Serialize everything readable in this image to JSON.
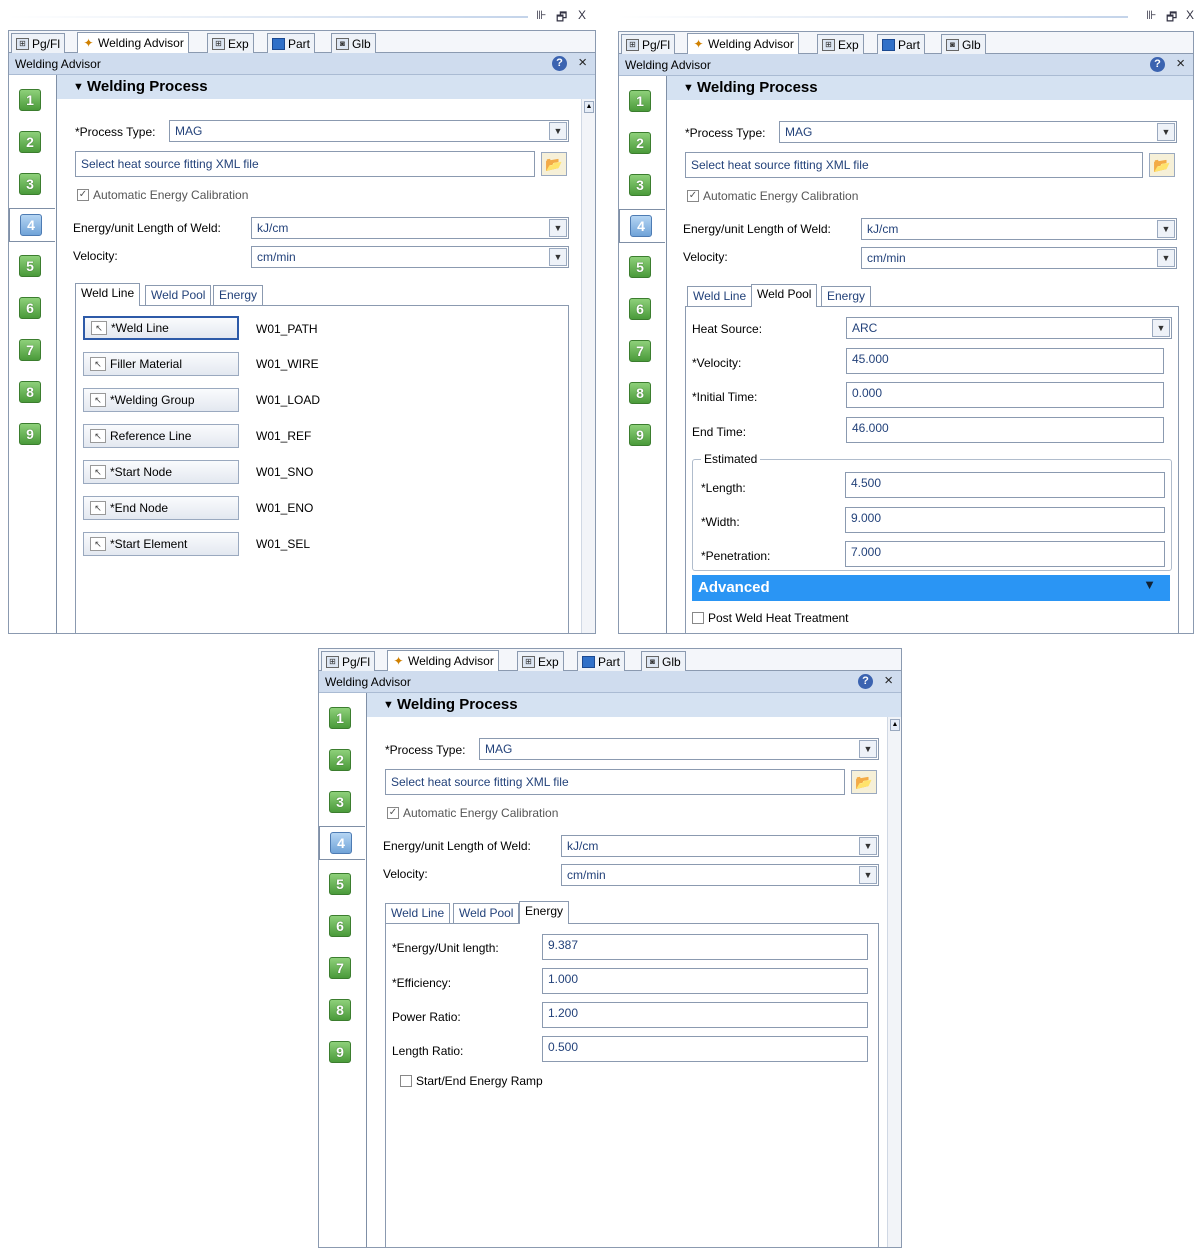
{
  "tabs": {
    "pgfl": "Pg/Fl",
    "welding_advisor": "Welding Advisor",
    "exp": "Exp",
    "part": "Part",
    "glb": "Glb"
  },
  "dock": {
    "pin": "⊪",
    "restore": "🗗",
    "close": "X"
  },
  "header": {
    "title": "Welding Advisor",
    "help": "?",
    "close": "×"
  },
  "steps": [
    "1",
    "2",
    "3",
    "4",
    "5",
    "6",
    "7",
    "8",
    "9"
  ],
  "section_title": "Welding Process",
  "process": {
    "process_type_label": "*Process Type:",
    "process_type_value": "MAG",
    "xml_placeholder": "Select heat source fitting XML file",
    "auto_calibration": "Automatic Energy Calibration",
    "energy_label": "Energy/unit Length of Weld:",
    "energy_unit": "kJ/cm",
    "velocity_label": "Velocity:",
    "velocity_unit": "cm/min"
  },
  "subtabs": {
    "weld_line": "Weld Line",
    "weld_pool": "Weld Pool",
    "energy": "Energy"
  },
  "weld_line": [
    {
      "label": "*Weld Line",
      "value": "W01_PATH"
    },
    {
      "label": "Filler Material",
      "value": "W01_WIRE"
    },
    {
      "label": "*Welding Group",
      "value": "W01_LOAD"
    },
    {
      "label": "Reference Line",
      "value": "W01_REF"
    },
    {
      "label": "*Start Node",
      "value": "W01_SNO"
    },
    {
      "label": "*End Node",
      "value": "W01_ENO"
    },
    {
      "label": "*Start Element",
      "value": "W01_SEL"
    }
  ],
  "weld_pool": {
    "heat_source_label": "Heat Source:",
    "heat_source_value": "ARC",
    "velocity_label": "*Velocity:",
    "velocity_value": "45.000",
    "initial_time_label": "*Initial Time:",
    "initial_time_value": "0.000",
    "end_time_label": "End Time:",
    "end_time_value": "46.000",
    "estimated_label": "Estimated",
    "length_label": "*Length:",
    "length_value": "4.500",
    "width_label": "*Width:",
    "width_value": "9.000",
    "penetration_label": "*Penetration:",
    "penetration_value": "7.000",
    "advanced_label": "Advanced",
    "pwht_label": "Post Weld Heat Treatment"
  },
  "energy": {
    "energy_unit_label": "*Energy/Unit length:",
    "energy_unit_value": "9.387",
    "efficiency_label": "*Efficiency:",
    "efficiency_value": "1.000",
    "power_ratio_label": "Power Ratio:",
    "power_ratio_value": "1.200",
    "length_ratio_label": "Length Ratio:",
    "length_ratio_value": "0.500",
    "ramp_label": "Start/End Energy Ramp"
  }
}
